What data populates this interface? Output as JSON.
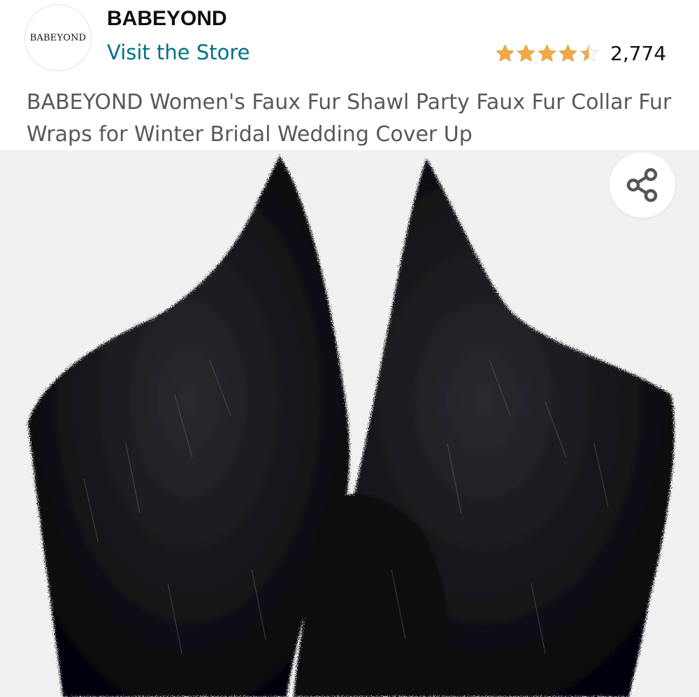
{
  "brand": {
    "logo_text": "BABEYOND",
    "name": "BABEYOND",
    "store_link": "Visit the Store"
  },
  "rating": {
    "stars": 4.5,
    "count": "2,774",
    "star_color": "#f3a847",
    "empty_star_color": "#d5d9d9"
  },
  "product": {
    "title": "BABEYOND Women's Faux Fur Shawl Party Faux Fur Collar Fur Wraps for Winter Bridal Wedding Cover Up"
  },
  "image": {
    "subject": "black faux fur collar shawl",
    "background_color": "#f1f1f1"
  },
  "icons": {
    "share": "share-icon"
  },
  "colors": {
    "link": "#007185",
    "title_text": "#565959",
    "brand_text": "#0f1111"
  }
}
